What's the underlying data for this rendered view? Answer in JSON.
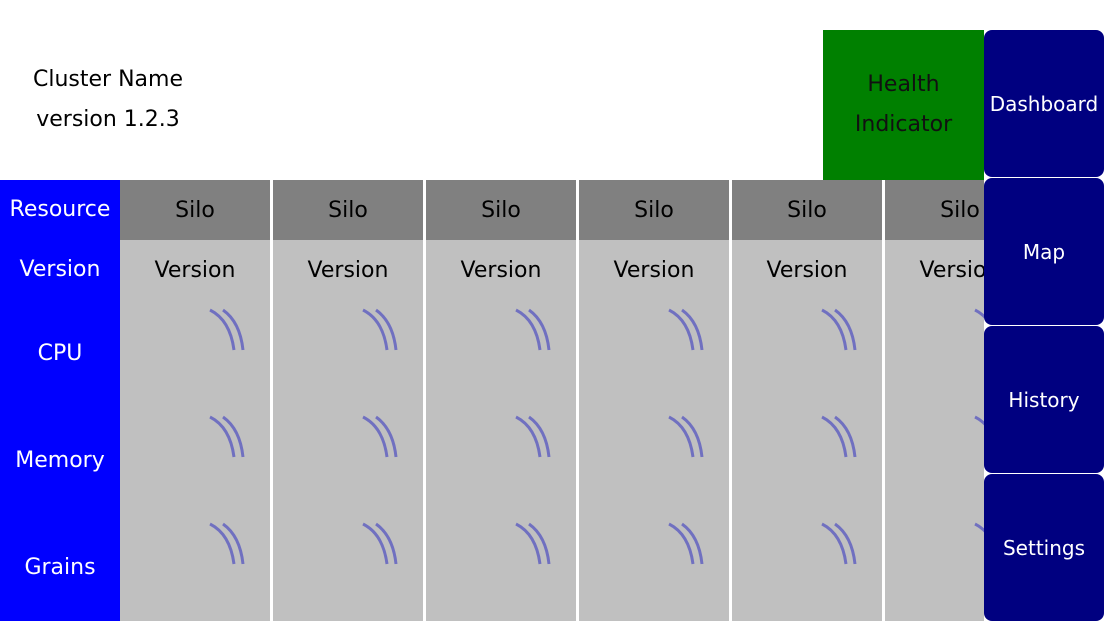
{
  "header": {
    "cluster_name": "Cluster Name",
    "version": "version 1.2.3",
    "health": [
      "Health",
      "Indicator"
    ],
    "health_color": "#008000"
  },
  "rows": {
    "resource": "Resource",
    "version": "Version",
    "cpu": "CPU",
    "memory": "Memory",
    "grains": "Grains"
  },
  "silos": [
    {
      "name": "Silo",
      "version": "Version"
    },
    {
      "name": "Silo",
      "version": "Version"
    },
    {
      "name": "Silo",
      "version": "Version"
    },
    {
      "name": "Silo",
      "version": "Version"
    },
    {
      "name": "Silo",
      "version": "Version"
    },
    {
      "name": "Silo",
      "version": "Version"
    }
  ],
  "metric_state": "loading-spinner-icon",
  "nav": [
    {
      "label": "Dashboard"
    },
    {
      "label": "Map"
    },
    {
      "label": "History"
    },
    {
      "label": "Settings"
    }
  ],
  "colors": {
    "labels_bg": "#0000ff",
    "nav_bg": "#000080",
    "header_bg": "#808080",
    "cell_bg": "#c0c0c0"
  }
}
